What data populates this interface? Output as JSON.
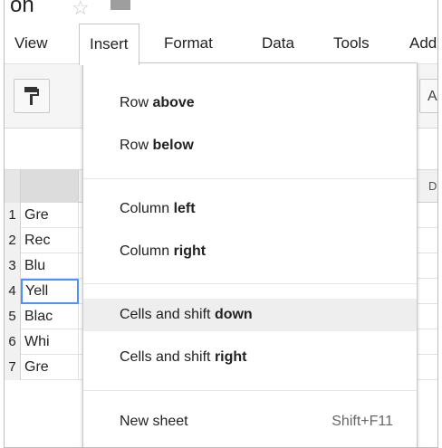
{
  "title": {
    "fragment": "on"
  },
  "icons": {
    "star": "star-icon",
    "folder": "folder-icon",
    "paint_format": "paint-format-icon"
  },
  "menubar": {
    "items": [
      {
        "label": "View"
      },
      {
        "label": "Insert"
      },
      {
        "label": "Format"
      },
      {
        "label": "Data"
      },
      {
        "label": "Tools"
      },
      {
        "label": "Add-"
      }
    ],
    "active": "Insert"
  },
  "toolbar": {
    "right_label": "A"
  },
  "grid": {
    "col_d_label": "D",
    "rows": [
      {
        "num": "1",
        "a": "Gre"
      },
      {
        "num": "2",
        "a": "Rec"
      },
      {
        "num": "3",
        "a": "Blu"
      },
      {
        "num": "4",
        "a": "Yell"
      },
      {
        "num": "5",
        "a": "Blac"
      },
      {
        "num": "6",
        "a": "Whi"
      },
      {
        "num": "7",
        "a": "Gre"
      }
    ],
    "selected_row": "4"
  },
  "insert_menu": {
    "items": [
      {
        "prefix": "Row ",
        "bold": "above"
      },
      {
        "prefix": "Row ",
        "bold": "below"
      },
      {
        "prefix": "Column ",
        "bold": "left"
      },
      {
        "prefix": "Column ",
        "bold": "right"
      },
      {
        "prefix": "Cells and shift ",
        "bold": "down"
      },
      {
        "prefix": "Cells and shift ",
        "bold": "right"
      },
      {
        "prefix": "New sheet",
        "bold": "",
        "shortcut": "Shift+F11"
      }
    ],
    "highlighted": "Cells and shift down"
  },
  "colors": {
    "accent_selection": "#4d90fe",
    "menu_highlight": "#eeeeee"
  }
}
